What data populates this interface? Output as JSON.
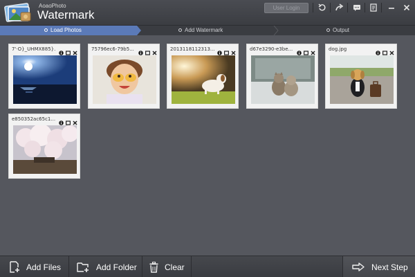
{
  "app": {
    "brand_small": "AoaoPhoto",
    "brand_title": "Watermark",
    "login_label": "User Login"
  },
  "titlebar_icons": [
    "undo-icon",
    "redo-icon",
    "chat-icon",
    "notes-icon",
    "minimize-icon",
    "close-icon"
  ],
  "steps": [
    {
      "label": "Load Photos",
      "active": true
    },
    {
      "label": "Add Watermark",
      "active": false
    },
    {
      "label": "Output",
      "active": false
    }
  ],
  "photos": [
    {
      "name": "7'·O}_UHMX885}..."
    },
    {
      "name": "75796ec6-79b5..."
    },
    {
      "name": "2013118112313..."
    },
    {
      "name": "d67e3290-e3be..."
    },
    {
      "name": "dog.jpg"
    },
    {
      "name": "e850352ac65c1..."
    }
  ],
  "toolbar": {
    "add_files": "Add Files",
    "add_folder": "Add Folder",
    "clear": "Clear",
    "next_step": "Next Step"
  },
  "colors": {
    "active_step": "#5b7ab8",
    "background": "#55575e",
    "toolbar": "#3e4045"
  }
}
